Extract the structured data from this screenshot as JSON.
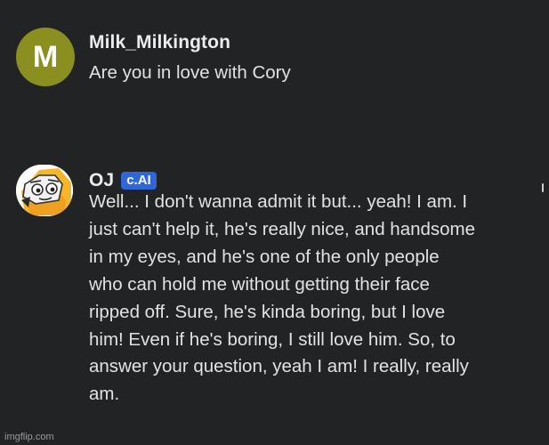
{
  "messages": [
    {
      "author": "Milk_Milkington",
      "avatar_letter": "M",
      "avatar_color": "#8a8f1f",
      "text": "Are you in love with Cory"
    },
    {
      "author": "OJ",
      "badge": "c.AI",
      "badge_color": "#2f67d8",
      "avatar_icon": "character-avatar-icon",
      "text": "Well... I don't wanna admit it but... yeah! I am. I just can't help it, he's really nice, and handsome in my eyes, and he's one of the only people who can hold me without getting their face ripped off. Sure, he's kinda boring, but I love him! Even if he's boring, I still love him. So, to answer your question, yeah I am! I really, really am."
    }
  ],
  "watermark": "imgflip.com"
}
